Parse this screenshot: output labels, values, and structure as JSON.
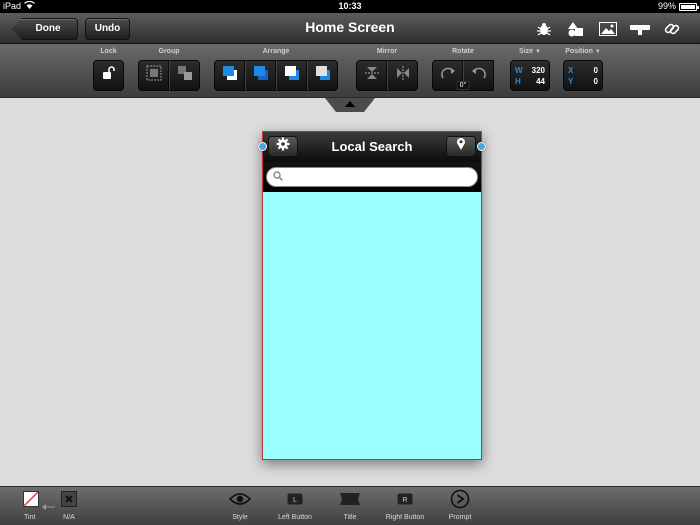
{
  "status": {
    "device": "iPad",
    "time": "10:33",
    "battery": "99%",
    "battery_level": 0.99
  },
  "nav": {
    "done_label": "Done",
    "undo_label": "Undo",
    "title": "Home Screen",
    "icons": [
      "bug-icon",
      "shapes-icon",
      "image-icon",
      "toolbar-icon",
      "link-icon"
    ]
  },
  "toolbar": {
    "lock_label": "Lock",
    "group_label": "Group",
    "arrange_label": "Arrange",
    "mirror_label": "Mirror",
    "rotate_label": "Rotate",
    "rotate_value": "0°",
    "size_label": "Size",
    "size": {
      "w": "320",
      "h": "44",
      "w_axis": "W",
      "h_axis": "H"
    },
    "position_label": "Position",
    "position": {
      "x": "0",
      "y": "0",
      "x_axis": "X",
      "y_axis": "Y"
    }
  },
  "preview": {
    "title": "Local Search",
    "search_value": "",
    "search_placeholder": "",
    "accent": "#99ffff",
    "border_color": "#c0303a"
  },
  "bottom": {
    "tint_label": "Tint",
    "na_label": "N/A",
    "style_label": "Style",
    "left_button_label": "Left Button",
    "title_label": "Title",
    "right_button_label": "Right Button",
    "prompt_label": "Prompt"
  }
}
